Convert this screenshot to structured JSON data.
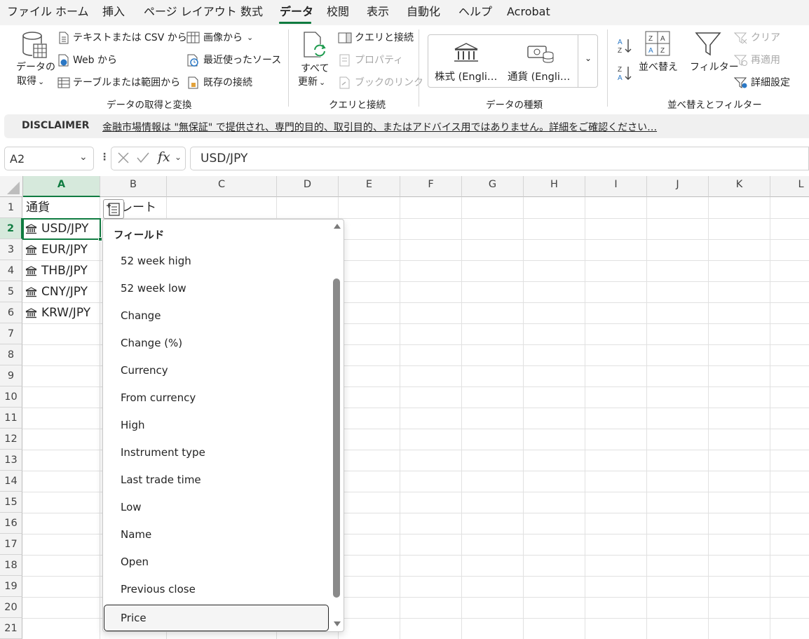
{
  "menu": {
    "tabs": [
      "ファイル",
      "ホーム",
      "挿入",
      "ページ レイアウト",
      "数式",
      "データ",
      "校閲",
      "表示",
      "自動化",
      "ヘルプ",
      "Acrobat"
    ],
    "active_tab": "データ"
  },
  "ribbon": {
    "get_data": {
      "line1": "データの",
      "line2": "取得"
    },
    "from_text_csv": "テキストまたは CSV から",
    "from_web": "Web から",
    "from_table": "テーブルまたは範囲から",
    "from_picture": "画像から",
    "recent_sources": "最近使ったソース",
    "existing_connections": "既存の接続",
    "group_get_transform": "データの取得と変換",
    "refresh_all": {
      "line1": "すべて",
      "line2": "更新"
    },
    "queries_connections": "クエリと接続",
    "properties": "プロパティ",
    "book_links": "ブックのリンク",
    "group_queries": "クエリと接続",
    "stocks": "株式 (Engli…",
    "currencies": "通貨 (Engli…",
    "group_data_types": "データの種類",
    "sort": "並べ替え",
    "filter": "フィルター",
    "clear": "クリア",
    "reapply": "再適用",
    "advanced": "詳細設定",
    "group_sort_filter": "並べ替えとフィルター"
  },
  "disclaimer": {
    "title": "DISCLAIMER",
    "text": "金融市場情報は \"無保証\" で提供され、専門的目的、取引目的、またはアドバイス用ではありません。詳細をご確認ください…"
  },
  "formula_bar": {
    "name_box": "A2",
    "fx": "fx",
    "value": "USD/JPY"
  },
  "grid": {
    "columns": [
      "A",
      "B",
      "C",
      "D",
      "E",
      "F",
      "G",
      "H",
      "I",
      "J",
      "K",
      "L"
    ],
    "rows": [
      "1",
      "2",
      "3",
      "4",
      "5",
      "6",
      "7",
      "8",
      "9",
      "10",
      "11",
      "12",
      "13",
      "14",
      "15",
      "16",
      "17",
      "18",
      "19",
      "20",
      "21"
    ],
    "selected_column": "A",
    "selected_row": "2",
    "a1": "通貨",
    "b1_partial": "レート",
    "currencies": [
      "USD/JPY",
      "EUR/JPY",
      "THB/JPY",
      "CNY/JPY",
      "KRW/JPY"
    ]
  },
  "dropdown": {
    "header": "フィールド",
    "items": [
      "52 week high",
      "52 week low",
      "Change",
      "Change (%)",
      "Currency",
      "From currency",
      "High",
      "Instrument type",
      "Last trade time",
      "Low",
      "Name",
      "Open",
      "Previous close",
      "Price"
    ],
    "highlighted": "Price"
  },
  "colors": {
    "accent": "#0f7b3f",
    "selection_border": "#107c41",
    "header_bg": "#f3f3f3"
  }
}
